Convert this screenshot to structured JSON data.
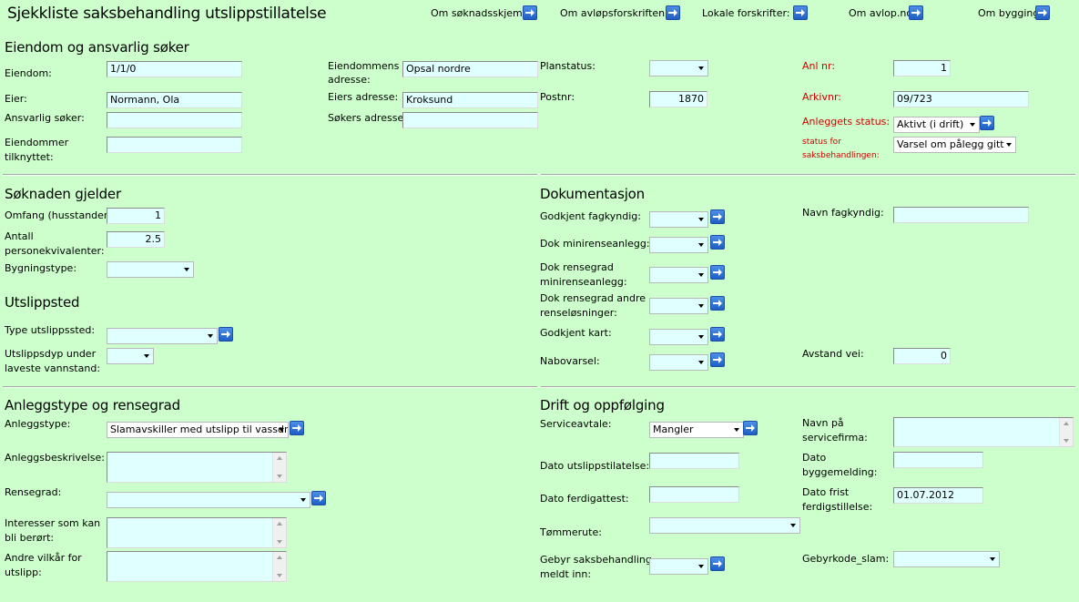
{
  "title": "Sjekkliste saksbehandling utslippstillatelse",
  "top_links": [
    "Om søknadsskjema:",
    "Om avløpsforskriften:",
    "Lokale forskrifter:",
    "Om avlop.no:",
    "Om bygging:"
  ],
  "sections": {
    "eiendom": "Eiendom og ansvarlig søker",
    "soknad": "Søknaden gjelder",
    "utslippssted": "Utslippsted",
    "dokumentasjon": "Dokumentasjon",
    "anleggstype": "Anleggstype og rensegrad",
    "drift": "Drift og oppfølging"
  },
  "eiendom": {
    "eiendom_label": "Eiendom:",
    "eiendom_value": "1/1/0",
    "eier_label": "Eier:",
    "eier_value": "Normann, Ola",
    "ansvarlig_label": "Ansvarlig søker:",
    "ansvarlig_value": "",
    "tilknyttet_label_1": "Eiendommer",
    "tilknyttet_label_2": "tilknyttet:",
    "tilknyttet_value": "",
    "adresse_label_1": "Eiendommens",
    "adresse_label_2": "adresse:",
    "adresse_value": "Opsal nordre",
    "eier_adresse_label": "Eiers adresse:",
    "eier_adresse_value": "Kroksund",
    "soker_adresse_label": "Søkers adresse:",
    "soker_adresse_value": "",
    "planstatus_label": "Planstatus:",
    "planstatus_value": "",
    "postnr_label": "Postnr:",
    "postnr_value": "1870",
    "anlnr_label": "Anl nr:",
    "anlnr_value": "1",
    "arkivnr_label": "Arkivnr:",
    "arkivnr_value": "09/723",
    "anleggets_status_label": "Anleggets status:",
    "anleggets_status_value": "Aktivt (i drift)",
    "status_saks_label_1": "status for",
    "status_saks_label_2": "saksbehandlingen:",
    "status_saks_value": "Varsel om pålegg gitt"
  },
  "soknad": {
    "omfang_label": "Omfang (husstander):",
    "omfang_value": "1",
    "pe_label_1": "Antall",
    "pe_label_2": "personekvivalenter:",
    "pe_value": "2.5",
    "bygningstype_label": "Bygningstype:",
    "bygningstype_value": ""
  },
  "utslipp": {
    "type_label": "Type utslippssted:",
    "type_value": "",
    "dyp_label_1": "Utslippsdyp under",
    "dyp_label_2": "laveste vannstand:",
    "dyp_value": ""
  },
  "dok": {
    "fagkyndig_label": "Godkjent fagkyndig:",
    "minirens_label": "Dok minirenseanlegg:",
    "rensegrad_mini_label_1": "Dok rensegrad",
    "rensegrad_mini_label_2": "minirenseanlegg:",
    "rensegrad_andre_label_1": "Dok rensegrad andre",
    "rensegrad_andre_label_2": "renseløsninger:",
    "kart_label": "Godkjent kart:",
    "nabovarsel_label": "Nabovarsel:",
    "navn_fagkyndig_label": "Navn fagkyndig:",
    "navn_fagkyndig_value": "",
    "avstand_vei_label": "Avstand vei:",
    "avstand_vei_value": "0"
  },
  "anlegg": {
    "type_label": "Anleggstype:",
    "type_value": "Slamavskiller med utslipp til vassdrag",
    "beskrivelse_label": "Anleggsbeskrivelse:",
    "rensegrad_label": "Rensegrad:",
    "rensegrad_value": "",
    "interesser_label_1": "Interesser som kan",
    "interesser_label_2": "bli berørt:",
    "vilkar_label_1": "Andre vilkår for",
    "vilkar_label_2": "utslipp:"
  },
  "drift": {
    "serviceavtale_label": "Serviceavtale:",
    "serviceavtale_value": "Mangler",
    "dato_tillatelse_label": "Dato utslippstilatelse:",
    "dato_tillatelse_value": "",
    "dato_ferdig_label": "Dato ferdigattest:",
    "dato_ferdig_value": "",
    "tommerute_label": "Tømmerute:",
    "tommerute_value": "",
    "gebyr_label_1": "Gebyr saksbehandling",
    "gebyr_label_2": "meldt inn:",
    "servicefirma_label_1": "Navn på",
    "servicefirma_label_2": "servicefirma:",
    "byggemelding_label_1": "Dato",
    "byggemelding_label_2": "byggemelding:",
    "byggemelding_value": "",
    "frist_label_1": "Dato frist",
    "frist_label_2": "ferdigstillelse:",
    "frist_value": "01.07.2012",
    "gebyrkode_label": "Gebyrkode_slam:",
    "gebyrkode_value": ""
  },
  "colors": {
    "background": "#ccffcc",
    "field": "#e0ffff",
    "required_label": "#d00000",
    "arrow_button": "#2f6fd6"
  }
}
